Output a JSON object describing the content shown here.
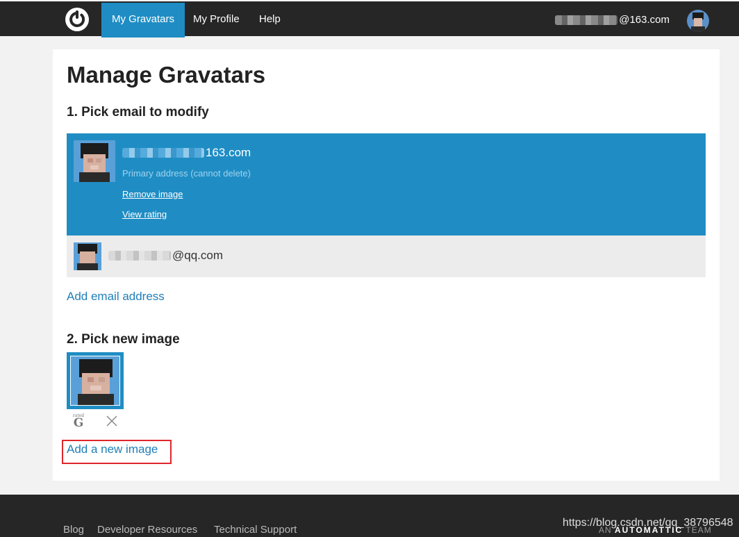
{
  "nav": {
    "items": [
      {
        "label": "My Gravatars",
        "active": true
      },
      {
        "label": "My Profile",
        "active": false
      },
      {
        "label": "Help",
        "active": false
      }
    ],
    "user_email_suffix": "@163.com"
  },
  "main": {
    "title": "Manage Gravatars",
    "step1_title": "1. Pick email to modify",
    "emails": [
      {
        "suffix": "163.com",
        "note": "Primary address (cannot delete)",
        "links": [
          "Remove image",
          "View rating"
        ],
        "selected": true
      },
      {
        "suffix": "@qq.com",
        "selected": false
      }
    ],
    "add_email_label": "Add email address",
    "step2_title": "2. Pick new image",
    "image_actions": {
      "rating_icon_small": "rated",
      "rating_icon_letter": "G",
      "rating_icon": "rated-g-icon",
      "delete_icon": "close-icon"
    },
    "add_image_label": "Add a new image"
  },
  "footer": {
    "links": [
      "Blog",
      "Developer Resources",
      "Technical Support"
    ],
    "brand_prefix": "AN",
    "brand_name": "AUTOMATTIC",
    "brand_suffix": "TEAM",
    "watermark": "https://blog.csdn.net/qq_38796548"
  },
  "colors": {
    "nav_bg": "#262626",
    "accent": "#1f8dc4",
    "link": "#1f7fb8",
    "highlight_border": "#e0252b"
  }
}
